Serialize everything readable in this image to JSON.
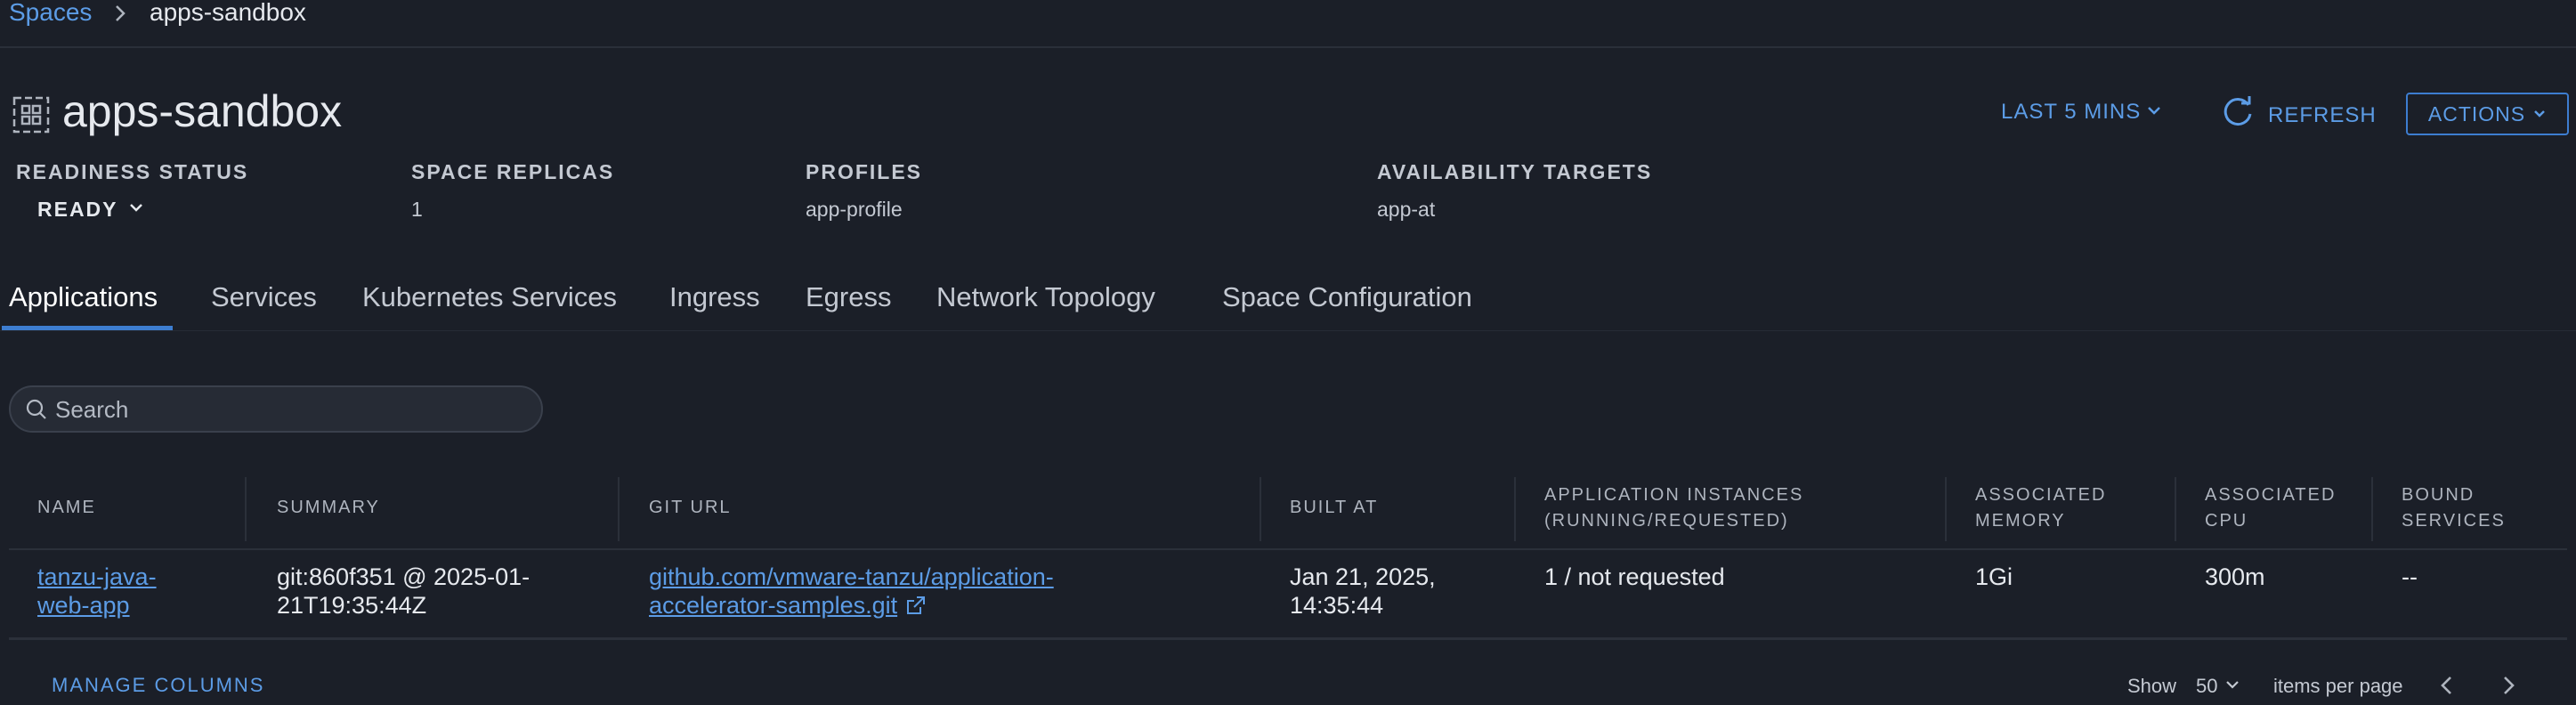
{
  "breadcrumb": {
    "parent": "Spaces",
    "current": "apps-sandbox"
  },
  "header": {
    "title": "apps-sandbox",
    "time_range": "LAST 5 MINS",
    "refresh_label": "REFRESH",
    "actions_label": "ACTIONS"
  },
  "meta": {
    "readiness_label": "READINESS STATUS",
    "readiness_value": "READY",
    "replicas_label": "SPACE REPLICAS",
    "replicas_value": "1",
    "profiles_label": "PROFILES",
    "profiles_value": "app-profile",
    "targets_label": "AVAILABILITY TARGETS",
    "targets_value": "app-at"
  },
  "tabs": [
    {
      "label": "Applications",
      "active": true
    },
    {
      "label": "Services"
    },
    {
      "label": "Kubernetes Services"
    },
    {
      "label": "Ingress"
    },
    {
      "label": "Egress"
    },
    {
      "label": "Network Topology"
    },
    {
      "label": "Space Configuration"
    }
  ],
  "search": {
    "placeholder": "Search",
    "value": ""
  },
  "table": {
    "columns": [
      {
        "line1": "NAME",
        "line2": ""
      },
      {
        "line1": "SUMMARY",
        "line2": ""
      },
      {
        "line1": "GIT URL",
        "line2": ""
      },
      {
        "line1": "BUILT AT",
        "line2": ""
      },
      {
        "line1": "APPLICATION INSTANCES",
        "line2": "(RUNNING/REQUESTED)"
      },
      {
        "line1": "ASSOCIATED",
        "line2": "MEMORY"
      },
      {
        "line1": "ASSOCIATED",
        "line2": "CPU"
      },
      {
        "line1": "BOUND",
        "line2": "SERVICES"
      }
    ],
    "rows": [
      {
        "name_l1": "tanzu-java-",
        "name_l2": "web-app",
        "summary_l1": "git:860f351 @ 2025-01-",
        "summary_l2": "21T19:35:44Z",
        "git_url_l1": "github.com/vmware-tanzu/application-",
        "git_url_l2": "accelerator-samples.git",
        "built_at_l1": "Jan 21, 2025,",
        "built_at_l2": "14:35:44",
        "instances": "1 / not requested",
        "memory": "1Gi",
        "cpu": "300m",
        "bound_services": "--"
      }
    ]
  },
  "footer": {
    "manage_columns": "MANAGE COLUMNS",
    "show_label": "Show",
    "page_size": "50",
    "items_per_page": "items per page"
  },
  "colors": {
    "accent": "#5c9ce6",
    "background": "#1b1f28",
    "tab_underline": "#3d7dd0"
  },
  "icons": [
    "chevron-right-icon",
    "space-grid-icon",
    "chevron-down-icon",
    "refresh-icon",
    "search-icon",
    "external-link-icon",
    "chevron-left-icon"
  ]
}
